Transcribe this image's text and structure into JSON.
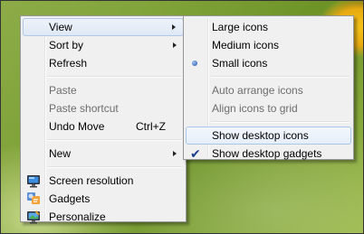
{
  "main_menu": {
    "items": [
      {
        "label": "View"
      },
      {
        "label": "Sort by"
      },
      {
        "label": "Refresh"
      },
      {
        "label": "Paste"
      },
      {
        "label": "Paste shortcut"
      },
      {
        "label": "Undo Move",
        "shortcut": "Ctrl+Z"
      },
      {
        "label": "New"
      },
      {
        "label": "Screen resolution",
        "icon": "monitor-icon"
      },
      {
        "label": "Gadgets",
        "icon": "gadgets-icon"
      },
      {
        "label": "Personalize",
        "icon": "personalize-icon"
      }
    ]
  },
  "view_menu": {
    "items": [
      {
        "label": "Large icons"
      },
      {
        "label": "Medium icons"
      },
      {
        "label": "Small icons",
        "selected": true
      },
      {
        "label": "Auto arrange icons"
      },
      {
        "label": "Align icons to grid"
      },
      {
        "label": "Show desktop icons"
      },
      {
        "label": "Show desktop gadgets",
        "checked": true
      }
    ]
  }
}
